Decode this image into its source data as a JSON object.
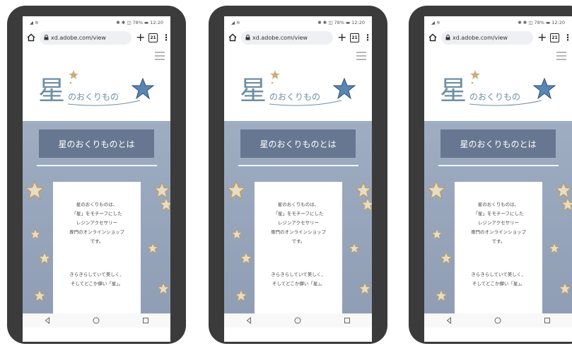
{
  "phones": [
    {
      "status": {
        "left": "◢ ≋",
        "right": "✱ ✱ ◫ 78% ▬ 12:20"
      },
      "browser": {
        "url": "xd.adobe.com/view",
        "tab_count": "21"
      },
      "logo": {
        "kanji": "星",
        "kana": "のおくりもの"
      },
      "section_title": "星のおくりものとは",
      "card": {
        "para1": [
          "星のおくりものは、",
          "「星」をモチーフにした",
          "レジンアクセサリー",
          "専門のオンラインショップ",
          "です。"
        ],
        "para2": [
          "きらきらしていて美しく、",
          "そしてどこか儚い「星」。"
        ]
      }
    },
    {
      "status": {
        "left": "◢ ≋",
        "right": "✱ ✱ ◫ 78% ▬ 12:20"
      },
      "browser": {
        "url": "xd.adobe.com/view",
        "tab_count": "21"
      },
      "logo": {
        "kanji": "星",
        "kana": "のおくりもの"
      },
      "section_title": "星のおくりものとは",
      "card": {
        "para1": [
          "星のおくりものは、",
          "「星」をモチーフにした",
          "レジンアクセサリー",
          "専門のオンラインショップ",
          "です。"
        ],
        "para2": [
          "きらきらしていて美しく、",
          "そしてどこか儚い「星」。"
        ]
      }
    },
    {
      "status": {
        "left": "◢ ≋",
        "right": "✱ ✱ ◫ 78% ▬ 12:20"
      },
      "browser": {
        "url": "xd.adobe.com/view",
        "tab_count": "21"
      },
      "logo": {
        "kanji": "星",
        "kana": "のおくりもの"
      },
      "section_title": "星のおくりものとは",
      "card": {
        "para1": [
          "星のおくりものは、",
          "「星」をモチーフにした",
          "レジンアクセサリー",
          "専門のオンラインショップ",
          "です。"
        ],
        "para2": [
          "きらきらしていて美しく、",
          "そしてどこか儚い「星」。"
        ]
      }
    }
  ],
  "colors": {
    "phone_frame": "#3b3b3b",
    "section_bg": "#9fadc3",
    "title_box": "#687791",
    "logo_text": "#6f8fa3",
    "star_accent": "#5a86b5",
    "star_gold": "#c9ad7a"
  }
}
